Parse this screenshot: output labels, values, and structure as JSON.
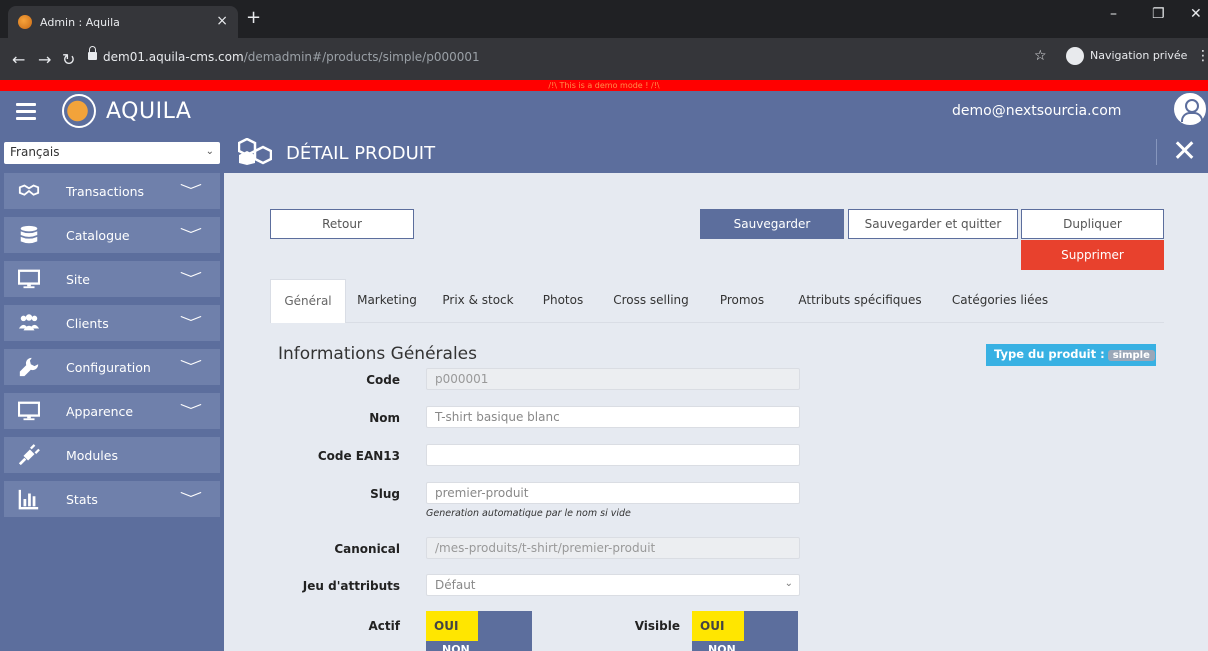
{
  "browser": {
    "tab_title": "Admin : Aquila",
    "tab_close": "×",
    "new_tab": "+",
    "url_host": "dem01.aquila-cms.com",
    "url_path": "/demadmin#/products/simple/p000001",
    "private_label": "Navigation privée",
    "controls": {
      "minimize": "–",
      "restore": "❐",
      "close": "✕"
    }
  },
  "demo_banner": "/!\\ This is a demo mode ! /!\\",
  "app": {
    "brand": "AQUILA",
    "user_email": "demo@nextsourcia.com"
  },
  "sidebar": {
    "language": "Français",
    "items": [
      {
        "label": "Transactions",
        "icon": "handshake-icon",
        "has_children": true
      },
      {
        "label": "Catalogue",
        "icon": "database-icon",
        "has_children": true
      },
      {
        "label": "Site",
        "icon": "monitor-icon",
        "has_children": true
      },
      {
        "label": "Clients",
        "icon": "users-icon",
        "has_children": true
      },
      {
        "label": "Configuration",
        "icon": "wrench-icon",
        "has_children": true
      },
      {
        "label": "Apparence",
        "icon": "monitor-icon",
        "has_children": true
      },
      {
        "label": "Modules",
        "icon": "plug-icon",
        "has_children": false
      },
      {
        "label": "Stats",
        "icon": "bar-chart-icon",
        "has_children": true
      }
    ]
  },
  "page": {
    "title": "DÉTAIL PRODUIT"
  },
  "actions": {
    "back": "Retour",
    "save": "Sauvegarder",
    "save_quit": "Sauvegarder et quitter",
    "duplicate": "Dupliquer",
    "delete": "Supprimer"
  },
  "tabs": [
    "Général",
    "Marketing",
    "Prix & stock",
    "Photos",
    "Cross selling",
    "Promos",
    "Attributs spécifiques",
    "Catégories liées"
  ],
  "form": {
    "section_title": "Informations Générales",
    "type_label": "Type du produit :",
    "type_value": "simple",
    "code_label": "Code",
    "code_value": "p000001",
    "name_label": "Nom",
    "name_value": "T-shirt basique blanc",
    "ean_label": "Code EAN13",
    "ean_value": "",
    "slug_label": "Slug",
    "slug_value": "premier-produit",
    "slug_help": "Generation automatique par le nom si vide",
    "canonical_label": "Canonical",
    "canonical_value": "/mes-produits/t-shirt/premier-produit",
    "attrset_label": "Jeu d'attributs",
    "attrset_value": "Défaut",
    "active_label": "Actif",
    "visible_label": "Visible",
    "on_label": "OUI",
    "off_label": "NON"
  }
}
